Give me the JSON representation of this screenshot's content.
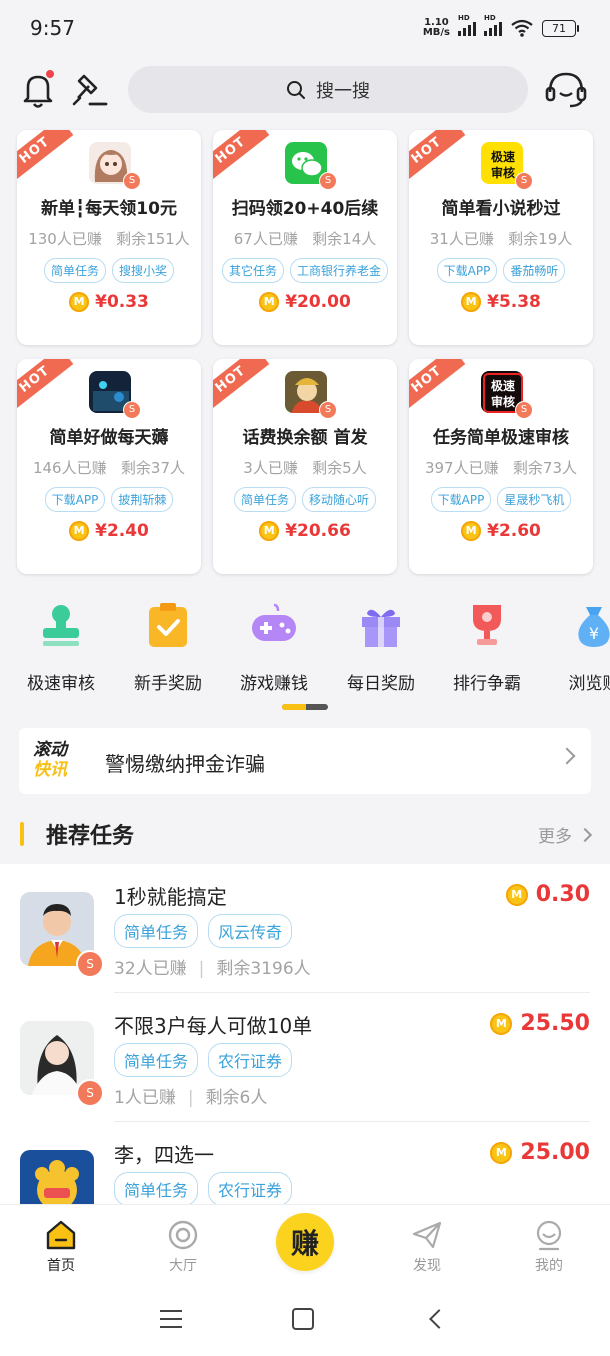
{
  "status": {
    "time": "9:57",
    "net_speed": "1.10",
    "net_unit": "MB/s",
    "sig1": "HD",
    "sig2": "HD",
    "battery": "71"
  },
  "header": {
    "search_placeholder": "搜一搜"
  },
  "cards": [
    {
      "hot": "HOT",
      "title": "新单┇每天领10元",
      "earned": "130人已赚",
      "remaining": "剩余151人",
      "tags": [
        "简单任务",
        "搜搜小奖"
      ],
      "price": "¥0.33",
      "thumb": "avatar-cartoon-girl"
    },
    {
      "hot": "HOT",
      "title": "扫码领20+40后续",
      "earned": "67人已赚",
      "remaining": "剩余14人",
      "tags": [
        "其它任务",
        "工商银行养老金"
      ],
      "price": "¥20.00",
      "thumb": "wechat-logo"
    },
    {
      "hot": "HOT",
      "title": "简单看小说秒过",
      "earned": "31人已赚",
      "remaining": "剩余19人",
      "tags": [
        "下载APP",
        "番茄畅听"
      ],
      "price": "¥5.38",
      "thumb": "jisu-shenhe-yellow"
    },
    {
      "hot": "HOT",
      "title": "简单好做每天薅",
      "earned": "146人已赚",
      "remaining": "剩余37人",
      "tags": [
        "下载APP",
        "披荆斩棘"
      ],
      "price": "¥2.40",
      "thumb": "game-dark"
    },
    {
      "hot": "HOT",
      "title": "话费换余额 首发",
      "earned": "3人已赚",
      "remaining": "剩余5人",
      "tags": [
        "简单任务",
        "移动随心听"
      ],
      "price": "¥20.66",
      "thumb": "wealth-god"
    },
    {
      "hot": "HOT",
      "title": "任务简单极速审核",
      "earned": "397人已赚",
      "remaining": "剩余73人",
      "tags": [
        "下载APP",
        "星晟秒飞机"
      ],
      "price": "¥2.60",
      "thumb": "jisu-shenhe-red"
    }
  ],
  "card_badge": "S",
  "coin_letter": "M",
  "thumb_text": {
    "jisu_line1": "极速",
    "jisu_line2": "审核"
  },
  "categories": [
    "极速审核",
    "新手奖励",
    "游戏赚钱",
    "每日奖励",
    "排行争霸",
    "浏览赚"
  ],
  "notice": {
    "logo_line1": "滚动",
    "logo_line2": "快讯",
    "text": "警惕缴纳押金诈骗"
  },
  "section": {
    "title": "推荐任务",
    "more": "更多"
  },
  "tasks": [
    {
      "name": "1秒就能搞定",
      "tags": [
        "简单任务",
        "风云传奇"
      ],
      "earned": "32人已赚",
      "remaining": "剩余3196人",
      "amount": "0.30"
    },
    {
      "name": "不限3户每人可做10单",
      "tags": [
        "简单任务",
        "农行证券"
      ],
      "earned": "1人已赚",
      "remaining": "剩余6人",
      "amount": "25.50"
    },
    {
      "name": "李，四选一",
      "tags": [
        "简单任务",
        "农行证券"
      ],
      "earned": "",
      "remaining": "",
      "amount": "25.00"
    }
  ],
  "meta_sep": "|",
  "nav": {
    "home": "首页",
    "hall": "大厅",
    "earn": "赚",
    "discover": "发现",
    "mine": "我的"
  },
  "colors": {
    "accent": "#f8c113",
    "price": "#ea3838",
    "tag": "#3aa2db",
    "hot": "#f06a51"
  }
}
